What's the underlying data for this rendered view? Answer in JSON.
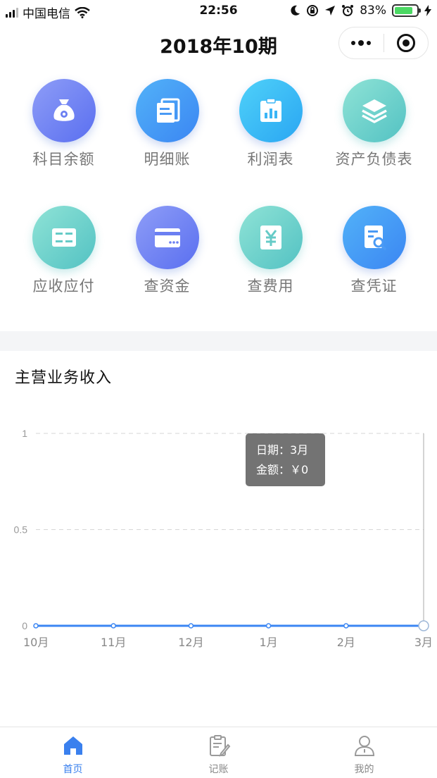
{
  "status_bar": {
    "carrier": "中国电信",
    "time": "22:56",
    "battery_percent": "83%",
    "battery_level": 0.83
  },
  "nav": {
    "title": "2018年10期"
  },
  "grid": [
    {
      "label": "科目余额",
      "icon": "money-bag-icon",
      "color": "purple"
    },
    {
      "label": "明细账",
      "icon": "document-stack-icon",
      "color": "blue"
    },
    {
      "label": "利润表",
      "icon": "bar-chart-clipboard-icon",
      "color": "cyan"
    },
    {
      "label": "资产负债表",
      "icon": "layers-icon",
      "color": "teal"
    },
    {
      "label": "应收应付",
      "icon": "card-list-icon",
      "color": "teal"
    },
    {
      "label": "查资金",
      "icon": "wallet-card-icon",
      "color": "purple"
    },
    {
      "label": "查费用",
      "icon": "yen-icon",
      "color": "teal"
    },
    {
      "label": "查凭证",
      "icon": "voucher-search-icon",
      "color": "blue"
    }
  ],
  "chart_section": {
    "title": "主营业务收入"
  },
  "chart_data": {
    "type": "line",
    "title": "主营业务收入",
    "categories": [
      "10月",
      "11月",
      "12月",
      "1月",
      "2月",
      "3月"
    ],
    "series": [
      {
        "values": [
          0,
          0,
          0,
          0,
          0,
          0
        ]
      }
    ],
    "y_ticks": [
      "0",
      "0.5",
      "1"
    ],
    "ylim": [
      0,
      1
    ],
    "grid": "horizontal-dashed",
    "line_color": "#3b86f3",
    "tooltip": {
      "date_label": "日期：3月",
      "amount_label": "金额：￥0"
    }
  },
  "tab_bar": {
    "items": [
      {
        "label": "首页",
        "icon": "home-icon",
        "active": true
      },
      {
        "label": "记账",
        "icon": "edit-note-icon",
        "active": false
      },
      {
        "label": "我的",
        "icon": "user-icon",
        "active": false
      }
    ]
  },
  "colors": {
    "accent": "#3a80ee",
    "muted": "#888888"
  }
}
